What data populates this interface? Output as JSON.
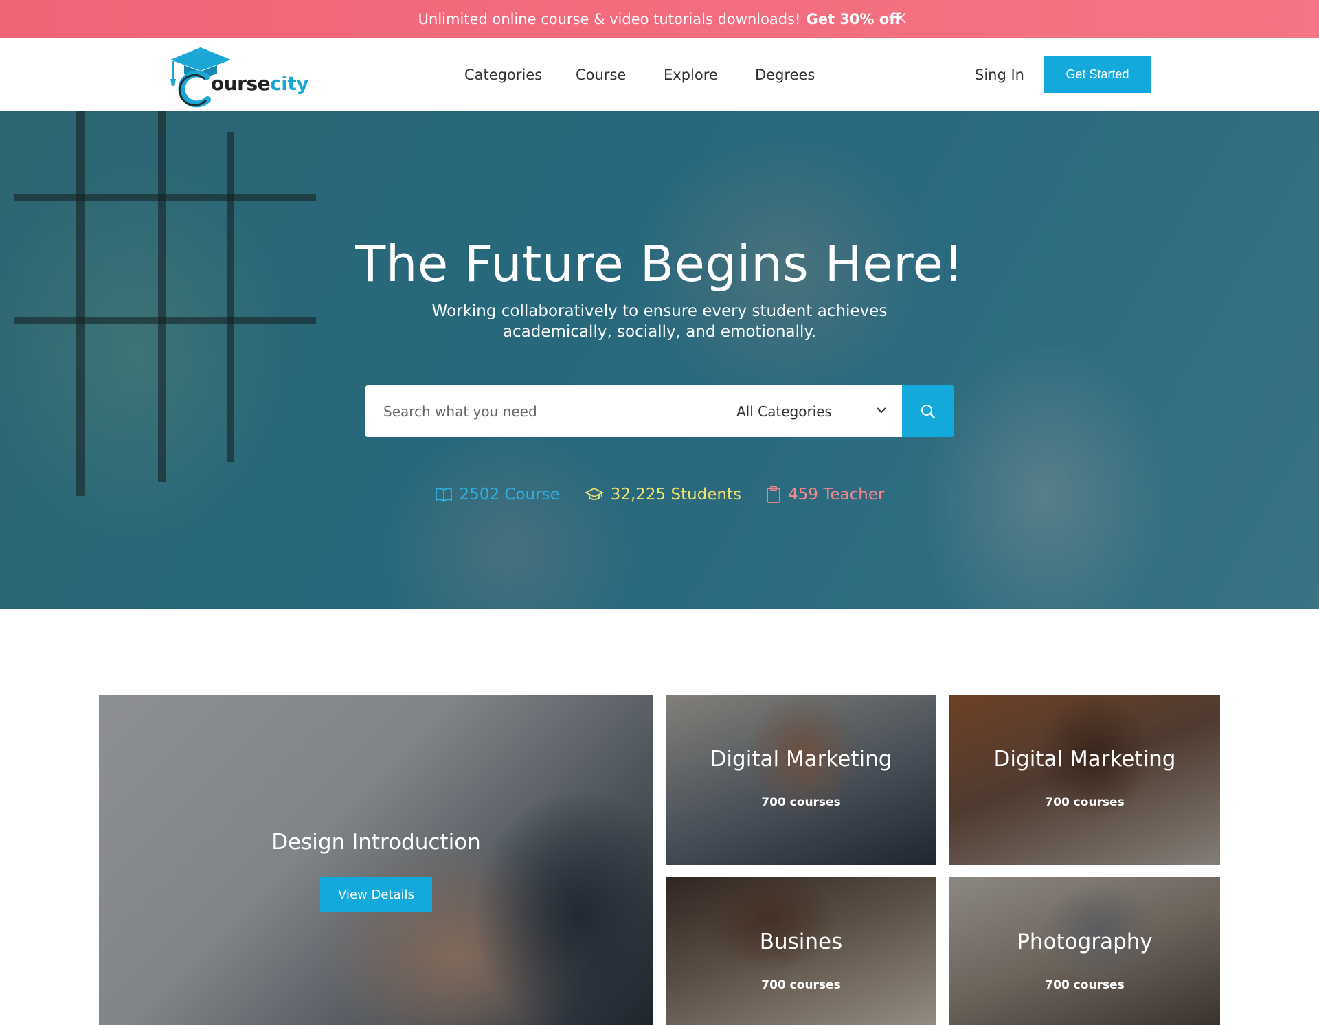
{
  "promo": {
    "text": "Unlimited online course & video tutorials downloads!",
    "highlight": "Get 30% off"
  },
  "brand": {
    "prefix": "ourse",
    "suffix": "city"
  },
  "nav": {
    "items": [
      "Categories",
      "Course",
      "Explore",
      "Degrees"
    ],
    "signin": "Sing In",
    "cta": "Get Started"
  },
  "hero": {
    "title": "The Future Begins Here!",
    "subtitle": "Working collaboratively to ensure every student achieves academically, socially, and emotionally.",
    "search_placeholder": "Search what you need",
    "category_selected": "All Categories",
    "stats": [
      {
        "text": "2502 Course",
        "color": "#2fb0e4",
        "icon": "book-icon"
      },
      {
        "text": "32,225 Students",
        "color": "#f3e36a",
        "icon": "graduation-cap-icon"
      },
      {
        "text": "459 Teacher",
        "color": "#f48a8f",
        "icon": "clipboard-icon"
      }
    ]
  },
  "categories": {
    "featured": {
      "title": "Design Introduction",
      "button": "View Details"
    },
    "cards": [
      {
        "title": "Digital Marketing",
        "count": "700 courses"
      },
      {
        "title": "Digital Marketing",
        "count": "700 courses"
      },
      {
        "title": "Busines",
        "count": "700 courses"
      },
      {
        "title": "Photography",
        "count": "700 courses"
      }
    ]
  },
  "colors": {
    "accent": "#13a9da",
    "promo": "#f06478"
  }
}
